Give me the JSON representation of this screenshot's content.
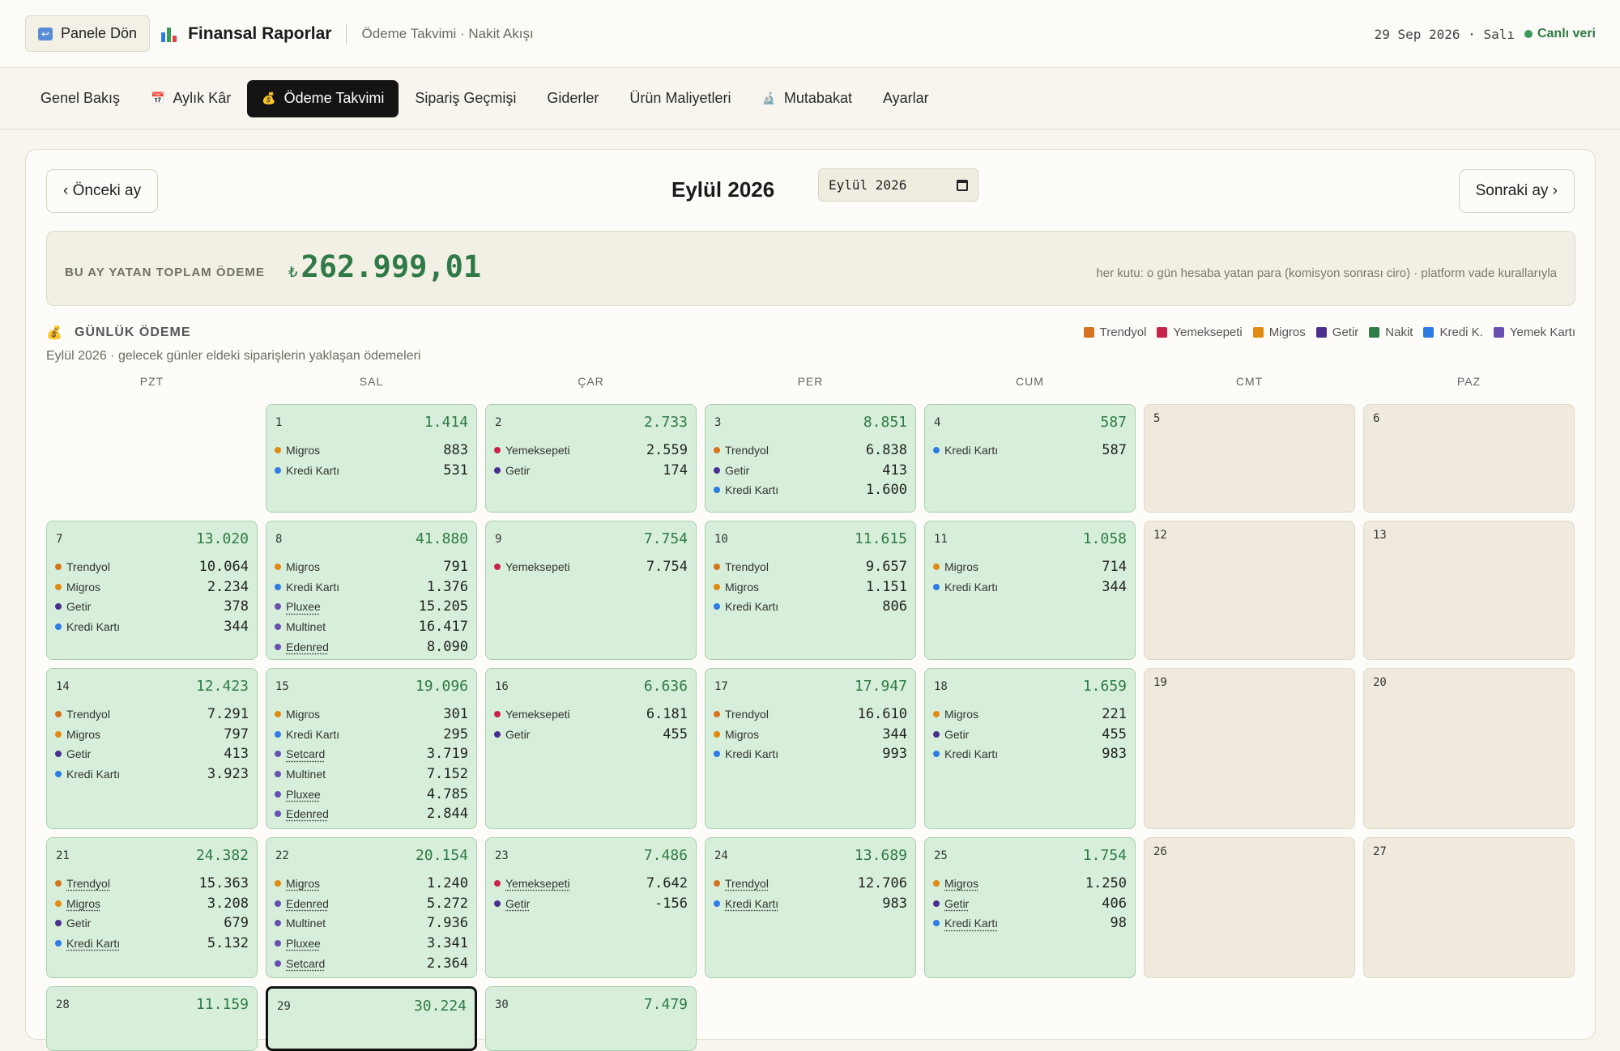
{
  "topbar": {
    "back_label": "Panele Dön",
    "title": "Finansal Raporlar",
    "subtitle": "Ödeme Takvimi · Nakit Akışı",
    "date": "29 Sep 2026 · Salı",
    "live": "Canlı veri"
  },
  "tabs": [
    {
      "label": "Genel Bakış",
      "icon": ""
    },
    {
      "label": "Aylık Kâr",
      "icon": "calendar-icon"
    },
    {
      "label": "Ödeme Takvimi",
      "icon": "money-bag-icon"
    },
    {
      "label": "Sipariş Geçmişi",
      "icon": ""
    },
    {
      "label": "Giderler",
      "icon": ""
    },
    {
      "label": "Ürün Maliyetleri",
      "icon": ""
    },
    {
      "label": "Mutabakat",
      "icon": "microscope-icon"
    },
    {
      "label": "Ayarlar",
      "icon": ""
    }
  ],
  "month": {
    "prev": "‹ Önceki ay",
    "next": "Sonraki ay ›",
    "title": "Eylül 2026",
    "picker": "Eylül 2026"
  },
  "summary": {
    "label": "BU AY YATAN TOPLAM ÖDEME",
    "currency": "₺",
    "amount": "262.999,01",
    "note": "her kutu: o gün hesaba yatan para (komisyon sonrası ciro) · platform vade kurallarıyla"
  },
  "section": {
    "title": "GÜNLÜK ÖDEME",
    "subtitle": "Eylül 2026 · gelecek günler eldeki siparişlerin yaklaşan ödemeleri"
  },
  "legend": [
    {
      "label": "Trendyol",
      "color": "#d4741f"
    },
    {
      "label": "Yemeksepeti",
      "color": "#c8244a"
    },
    {
      "label": "Migros",
      "color": "#e08a12"
    },
    {
      "label": "Getir",
      "color": "#4b2f8f"
    },
    {
      "label": "Nakit",
      "color": "#2e7d47"
    },
    {
      "label": "Kredi K.",
      "color": "#2f7be6"
    },
    {
      "label": "Yemek Kartı",
      "color": "#6a4fb3"
    }
  ],
  "weekdays": [
    "PZT",
    "SAL",
    "ÇAR",
    "PER",
    "CUM",
    "CMT",
    "PAZ"
  ],
  "days": [
    {
      "day": "",
      "blank": true
    },
    {
      "day": "1",
      "total": "1.414",
      "rows": [
        [
          "Migros",
          "883"
        ],
        [
          "Kredi Kartı",
          "531"
        ]
      ]
    },
    {
      "day": "2",
      "total": "2.733",
      "rows": [
        [
          "Yemeksepeti",
          "2.559"
        ],
        [
          "Getir",
          "174"
        ]
      ]
    },
    {
      "day": "3",
      "total": "8.851",
      "rows": [
        [
          "Trendyol",
          "6.838"
        ],
        [
          "Getir",
          "413"
        ],
        [
          "Kredi Kartı",
          "1.600"
        ]
      ]
    },
    {
      "day": "4",
      "total": "587",
      "rows": [
        [
          "Kredi Kartı",
          "587"
        ]
      ]
    },
    {
      "day": "5"
    },
    {
      "day": "6"
    },
    {
      "day": "7",
      "total": "13.020",
      "rows": [
        [
          "Trendyol",
          "10.064"
        ],
        [
          "Migros",
          "2.234"
        ],
        [
          "Getir",
          "378"
        ],
        [
          "Kredi Kartı",
          "344"
        ]
      ]
    },
    {
      "day": "8",
      "total": "41.880",
      "rows": [
        [
          "Migros",
          "791"
        ],
        [
          "Kredi Kartı",
          "1.376"
        ],
        [
          "Pluxee",
          "15.205"
        ],
        [
          "Multinet",
          "16.417"
        ],
        [
          "Edenred",
          "8.090"
        ]
      ]
    },
    {
      "day": "9",
      "total": "7.754",
      "rows": [
        [
          "Yemeksepeti",
          "7.754"
        ]
      ]
    },
    {
      "day": "10",
      "total": "11.615",
      "rows": [
        [
          "Trendyol",
          "9.657"
        ],
        [
          "Migros",
          "1.151"
        ],
        [
          "Kredi Kartı",
          "806"
        ]
      ]
    },
    {
      "day": "11",
      "total": "1.058",
      "rows": [
        [
          "Migros",
          "714"
        ],
        [
          "Kredi Kartı",
          "344"
        ]
      ]
    },
    {
      "day": "12"
    },
    {
      "day": "13"
    },
    {
      "day": "14",
      "total": "12.423",
      "rows": [
        [
          "Trendyol",
          "7.291"
        ],
        [
          "Migros",
          "797"
        ],
        [
          "Getir",
          "413"
        ],
        [
          "Kredi Kartı",
          "3.923"
        ]
      ]
    },
    {
      "day": "15",
      "total": "19.096",
      "rows": [
        [
          "Migros",
          "301"
        ],
        [
          "Kredi Kartı",
          "295"
        ],
        [
          "Setcard",
          "3.719"
        ],
        [
          "Multinet",
          "7.152"
        ],
        [
          "Pluxee",
          "4.785"
        ],
        [
          "Edenred",
          "2.844"
        ]
      ]
    },
    {
      "day": "16",
      "total": "6.636",
      "rows": [
        [
          "Yemeksepeti",
          "6.181"
        ],
        [
          "Getir",
          "455"
        ]
      ]
    },
    {
      "day": "17",
      "total": "17.947",
      "rows": [
        [
          "Trendyol",
          "16.610"
        ],
        [
          "Migros",
          "344"
        ],
        [
          "Kredi Kartı",
          "993"
        ]
      ]
    },
    {
      "day": "18",
      "total": "1.659",
      "rows": [
        [
          "Migros",
          "221"
        ],
        [
          "Getir",
          "455"
        ],
        [
          "Kredi Kartı",
          "983"
        ]
      ]
    },
    {
      "day": "19"
    },
    {
      "day": "20"
    },
    {
      "day": "21",
      "total": "24.382",
      "rows": [
        [
          "Trendyol",
          "15.363"
        ],
        [
          "Migros",
          "3.208"
        ],
        [
          "Getir",
          "679"
        ],
        [
          "Kredi Kartı",
          "5.132"
        ]
      ]
    },
    {
      "day": "22",
      "total": "20.154",
      "rows": [
        [
          "Migros",
          "1.240"
        ],
        [
          "Edenred",
          "5.272"
        ],
        [
          "Multinet",
          "7.936"
        ],
        [
          "Pluxee",
          "3.341"
        ],
        [
          "Setcard",
          "2.364"
        ]
      ]
    },
    {
      "day": "23",
      "total": "7.486",
      "rows": [
        [
          "Yemeksepeti",
          "7.642"
        ],
        [
          "Getir",
          "-156"
        ]
      ]
    },
    {
      "day": "24",
      "total": "13.689",
      "rows": [
        [
          "Trendyol",
          "12.706"
        ],
        [
          "Kredi Kartı",
          "983"
        ]
      ]
    },
    {
      "day": "25",
      "total": "1.754",
      "rows": [
        [
          "Migros",
          "1.250"
        ],
        [
          "Getir",
          "406"
        ],
        [
          "Kredi Kartı",
          "98"
        ]
      ]
    },
    {
      "day": "26"
    },
    {
      "day": "27"
    },
    {
      "day": "28",
      "total": "11.159",
      "rows": []
    },
    {
      "day": "29",
      "total": "30.224",
      "rows": [],
      "today": true
    },
    {
      "day": "30",
      "total": "7.479",
      "rows": []
    }
  ]
}
